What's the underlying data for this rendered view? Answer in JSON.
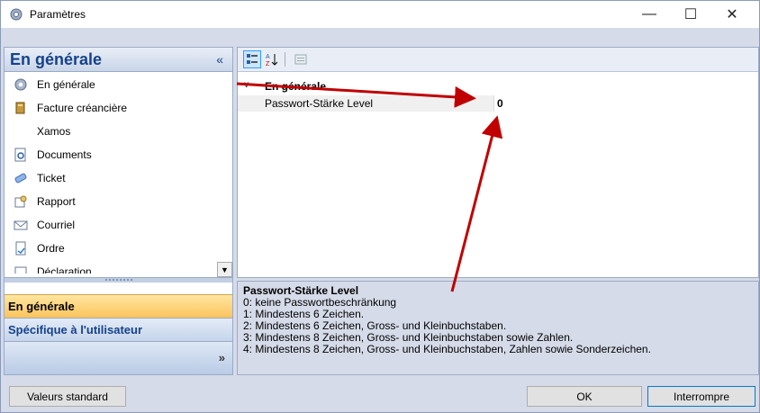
{
  "window": {
    "title": "Paramètres"
  },
  "nav": {
    "header": "En générale",
    "collapse_glyph": "«",
    "items": [
      {
        "label": "En générale",
        "icon": "gear-icon"
      },
      {
        "label": "Facture créancière",
        "icon": "invoice-icon"
      },
      {
        "label": "Xamos",
        "icon": ""
      },
      {
        "label": "Documents",
        "icon": "documents-icon"
      },
      {
        "label": "Ticket",
        "icon": "ticket-icon"
      },
      {
        "label": "Rapport",
        "icon": "report-icon"
      },
      {
        "label": "Courriel",
        "icon": "mail-icon"
      },
      {
        "label": "Ordre",
        "icon": "order-icon"
      },
      {
        "label": "Déclaration",
        "icon": "declaration-icon"
      }
    ],
    "buttons": [
      "En générale",
      "Spécifique à l'utilisateur"
    ],
    "more_glyph": "»"
  },
  "grid": {
    "category": "En générale",
    "property": {
      "name": "Passwort-Stärke Level",
      "value": "0"
    }
  },
  "description": {
    "title": "Passwort-Stärke Level",
    "lines": [
      "0: keine Passwortbeschränkung",
      "1: Mindestens 6 Zeichen.",
      "2: Mindestens 6 Zeichen, Gross- und Kleinbuchstaben.",
      "3: Mindestens 8 Zeichen, Gross- und Kleinbuchstaben sowie Zahlen.",
      "4: Mindestens 8 Zeichen, Gross- und Kleinbuchstaben, Zahlen sowie Sonderzeichen."
    ]
  },
  "footer": {
    "defaults": "Valeurs standard",
    "ok": "OK",
    "cancel": "Interrompre"
  },
  "colors": {
    "highlight": "#c00000",
    "active_nav": "#fcc45c",
    "nav_text": "#15428b"
  }
}
